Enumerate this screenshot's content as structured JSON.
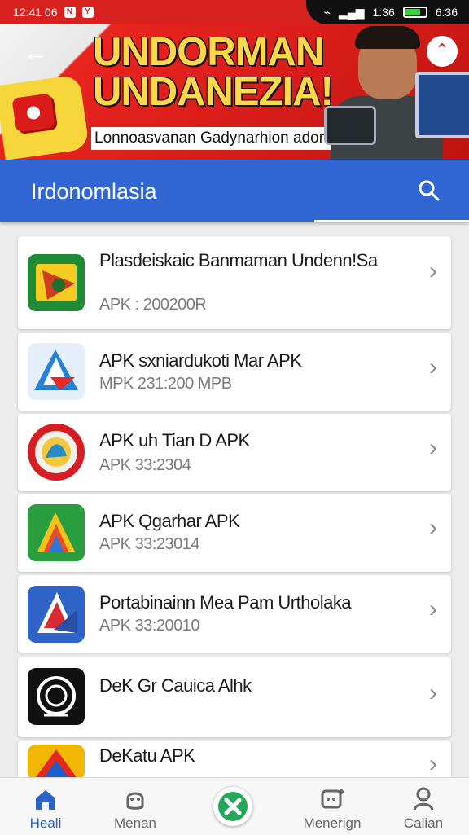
{
  "status_bar": {
    "time": "12:41 06",
    "badge_1": "N",
    "badge_2": "Y",
    "right_status": "1:36",
    "right_time": "6:36",
    "battery_level": 0.68
  },
  "banner": {
    "title_line_1": "UNDORMAN",
    "title_line_2": "UNDANEZIA!",
    "subtitle": "Lonnoasvanan Gadynarhion adomnnn?"
  },
  "header": {
    "title": "Irdonomlasia"
  },
  "apps": [
    {
      "title": "Plasdeiskaic Banmaman Undenn!Sa",
      "meta": "APK : 200200R"
    },
    {
      "title": "APK sxniardukoti Mar APK",
      "meta": "MPK 231:200 MPB"
    },
    {
      "title": "APK uh Tian D APK",
      "meta": "APK 33:2304"
    },
    {
      "title": "APK Qgarhar APK",
      "meta": "APK 33:23014"
    },
    {
      "title": "Portabinainn Mea Pam Urtholaka",
      "meta": "APK 33:20010"
    },
    {
      "title": "DeK Gr Cauica Alhk",
      "meta": ""
    },
    {
      "title": "DeKatu APK",
      "meta": ""
    }
  ],
  "bottom_nav": [
    {
      "label": "Heali",
      "icon": "home-icon"
    },
    {
      "label": "Menan",
      "icon": "support-icon"
    },
    {
      "label": "",
      "icon": "close-icon"
    },
    {
      "label": "Menerign",
      "icon": "message-icon"
    },
    {
      "label": "Calian",
      "icon": "profile-icon"
    }
  ],
  "colors": {
    "status_red": "#d7211e",
    "header_blue": "#3266d3",
    "active_nav": "#2a63c5",
    "accent_green": "#26a65b"
  }
}
